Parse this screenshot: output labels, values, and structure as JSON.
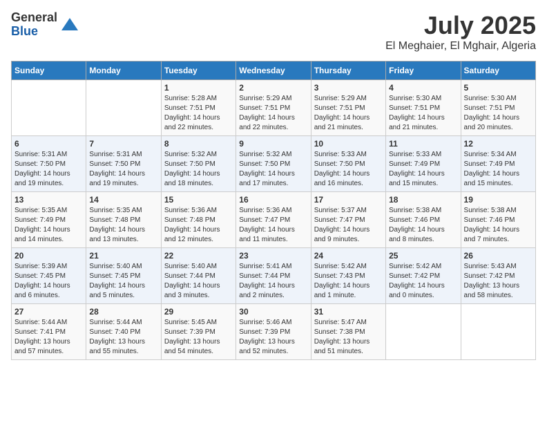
{
  "logo": {
    "general": "General",
    "blue": "Blue"
  },
  "title": "July 2025",
  "subtitle": "El Meghaier, El Mghair, Algeria",
  "days_of_week": [
    "Sunday",
    "Monday",
    "Tuesday",
    "Wednesday",
    "Thursday",
    "Friday",
    "Saturday"
  ],
  "weeks": [
    [
      {
        "day": "",
        "detail": ""
      },
      {
        "day": "",
        "detail": ""
      },
      {
        "day": "1",
        "detail": "Sunrise: 5:28 AM\nSunset: 7:51 PM\nDaylight: 14 hours and 22 minutes."
      },
      {
        "day": "2",
        "detail": "Sunrise: 5:29 AM\nSunset: 7:51 PM\nDaylight: 14 hours and 22 minutes."
      },
      {
        "day": "3",
        "detail": "Sunrise: 5:29 AM\nSunset: 7:51 PM\nDaylight: 14 hours and 21 minutes."
      },
      {
        "day": "4",
        "detail": "Sunrise: 5:30 AM\nSunset: 7:51 PM\nDaylight: 14 hours and 21 minutes."
      },
      {
        "day": "5",
        "detail": "Sunrise: 5:30 AM\nSunset: 7:51 PM\nDaylight: 14 hours and 20 minutes."
      }
    ],
    [
      {
        "day": "6",
        "detail": "Sunrise: 5:31 AM\nSunset: 7:50 PM\nDaylight: 14 hours and 19 minutes."
      },
      {
        "day": "7",
        "detail": "Sunrise: 5:31 AM\nSunset: 7:50 PM\nDaylight: 14 hours and 19 minutes."
      },
      {
        "day": "8",
        "detail": "Sunrise: 5:32 AM\nSunset: 7:50 PM\nDaylight: 14 hours and 18 minutes."
      },
      {
        "day": "9",
        "detail": "Sunrise: 5:32 AM\nSunset: 7:50 PM\nDaylight: 14 hours and 17 minutes."
      },
      {
        "day": "10",
        "detail": "Sunrise: 5:33 AM\nSunset: 7:50 PM\nDaylight: 14 hours and 16 minutes."
      },
      {
        "day": "11",
        "detail": "Sunrise: 5:33 AM\nSunset: 7:49 PM\nDaylight: 14 hours and 15 minutes."
      },
      {
        "day": "12",
        "detail": "Sunrise: 5:34 AM\nSunset: 7:49 PM\nDaylight: 14 hours and 15 minutes."
      }
    ],
    [
      {
        "day": "13",
        "detail": "Sunrise: 5:35 AM\nSunset: 7:49 PM\nDaylight: 14 hours and 14 minutes."
      },
      {
        "day": "14",
        "detail": "Sunrise: 5:35 AM\nSunset: 7:48 PM\nDaylight: 14 hours and 13 minutes."
      },
      {
        "day": "15",
        "detail": "Sunrise: 5:36 AM\nSunset: 7:48 PM\nDaylight: 14 hours and 12 minutes."
      },
      {
        "day": "16",
        "detail": "Sunrise: 5:36 AM\nSunset: 7:47 PM\nDaylight: 14 hours and 11 minutes."
      },
      {
        "day": "17",
        "detail": "Sunrise: 5:37 AM\nSunset: 7:47 PM\nDaylight: 14 hours and 9 minutes."
      },
      {
        "day": "18",
        "detail": "Sunrise: 5:38 AM\nSunset: 7:46 PM\nDaylight: 14 hours and 8 minutes."
      },
      {
        "day": "19",
        "detail": "Sunrise: 5:38 AM\nSunset: 7:46 PM\nDaylight: 14 hours and 7 minutes."
      }
    ],
    [
      {
        "day": "20",
        "detail": "Sunrise: 5:39 AM\nSunset: 7:45 PM\nDaylight: 14 hours and 6 minutes."
      },
      {
        "day": "21",
        "detail": "Sunrise: 5:40 AM\nSunset: 7:45 PM\nDaylight: 14 hours and 5 minutes."
      },
      {
        "day": "22",
        "detail": "Sunrise: 5:40 AM\nSunset: 7:44 PM\nDaylight: 14 hours and 3 minutes."
      },
      {
        "day": "23",
        "detail": "Sunrise: 5:41 AM\nSunset: 7:44 PM\nDaylight: 14 hours and 2 minutes."
      },
      {
        "day": "24",
        "detail": "Sunrise: 5:42 AM\nSunset: 7:43 PM\nDaylight: 14 hours and 1 minute."
      },
      {
        "day": "25",
        "detail": "Sunrise: 5:42 AM\nSunset: 7:42 PM\nDaylight: 14 hours and 0 minutes."
      },
      {
        "day": "26",
        "detail": "Sunrise: 5:43 AM\nSunset: 7:42 PM\nDaylight: 13 hours and 58 minutes."
      }
    ],
    [
      {
        "day": "27",
        "detail": "Sunrise: 5:44 AM\nSunset: 7:41 PM\nDaylight: 13 hours and 57 minutes."
      },
      {
        "day": "28",
        "detail": "Sunrise: 5:44 AM\nSunset: 7:40 PM\nDaylight: 13 hours and 55 minutes."
      },
      {
        "day": "29",
        "detail": "Sunrise: 5:45 AM\nSunset: 7:39 PM\nDaylight: 13 hours and 54 minutes."
      },
      {
        "day": "30",
        "detail": "Sunrise: 5:46 AM\nSunset: 7:39 PM\nDaylight: 13 hours and 52 minutes."
      },
      {
        "day": "31",
        "detail": "Sunrise: 5:47 AM\nSunset: 7:38 PM\nDaylight: 13 hours and 51 minutes."
      },
      {
        "day": "",
        "detail": ""
      },
      {
        "day": "",
        "detail": ""
      }
    ]
  ]
}
